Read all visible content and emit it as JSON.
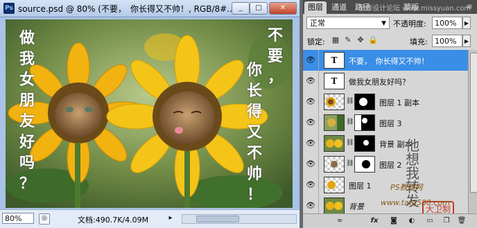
{
  "document": {
    "app_logo": "Ps",
    "title": "source.psd @ 80% (不要，　你长得又不帅！, RGB/8#...",
    "window_buttons": {
      "minimize": "_",
      "restore": "□",
      "close": "✕"
    },
    "canvas": {
      "left_text": [
        "做",
        "我",
        "女",
        "朋",
        "友",
        "好",
        "吗",
        "？"
      ],
      "right_text_col1": [
        "不",
        "要",
        "，"
      ],
      "right_text_col2": [
        "你",
        "长",
        "得",
        "又",
        "不",
        "帅",
        "！"
      ]
    },
    "status": {
      "zoom": "80%",
      "doc_size": "文档:490.7K/4.09M",
      "arrow": "▸"
    }
  },
  "layers_panel": {
    "tabs": [
      "图层",
      "通道",
      "路径",
      "蒙版"
    ],
    "top_watermark": "思缘设计论坛 www.missyuan.com",
    "blend_mode": "正常",
    "opacity_label": "不透明度:",
    "opacity_value": "100%",
    "lock_label": "锁定:",
    "fill_label": "填充:",
    "fill_value": "100%",
    "layers": [
      {
        "name": "不要，　你长得又不帅！",
        "type": "text",
        "selected": true,
        "thumb": "T"
      },
      {
        "name": "做我女朋友好吗？",
        "type": "text",
        "selected": false,
        "thumb": "T"
      },
      {
        "name": "图层 1 副本",
        "type": "masked",
        "selected": false
      },
      {
        "name": "图层 3",
        "type": "masked",
        "selected": false
      },
      {
        "name": "背景 副本",
        "type": "masked",
        "selected": false
      },
      {
        "name": "图层 2",
        "type": "masked",
        "selected": false
      },
      {
        "name": "图层 1",
        "type": "image",
        "selected": false
      },
      {
        "name": "背景",
        "type": "background",
        "selected": false
      }
    ],
    "signature": "他想我转发",
    "seal_text": "大卫制作",
    "watermark1": "PS教程网",
    "watermark2": "www.tata580.com",
    "bottom_icons": [
      "link-icon",
      "fx-icon",
      "mask-icon",
      "adjustment-icon",
      "folder-icon",
      "new-layer-icon",
      "trash-icon"
    ]
  },
  "colors": {
    "selection": "#3a8ee6",
    "title_bar": "#b4c9e8",
    "panel_bg": "#d6d6d6"
  }
}
